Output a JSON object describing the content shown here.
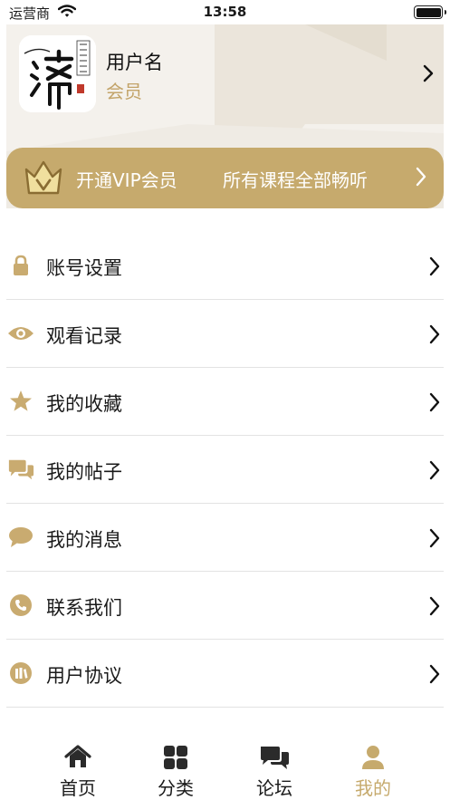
{
  "status_bar": {
    "carrier": "运营商",
    "time": "13:58"
  },
  "profile": {
    "username": "用户名",
    "member_level": "会员"
  },
  "vip_banner": {
    "open_label": "开通VIP会员",
    "description": "所有课程全部畅听"
  },
  "menu": {
    "items": [
      {
        "label": "账号设置",
        "icon": "lock-icon"
      },
      {
        "label": "观看记录",
        "icon": "eye-icon"
      },
      {
        "label": "我的收藏",
        "icon": "star-icon"
      },
      {
        "label": "我的帖子",
        "icon": "chat-bubbles-icon"
      },
      {
        "label": "我的消息",
        "icon": "message-icon"
      },
      {
        "label": "联系我们",
        "icon": "phone-icon"
      },
      {
        "label": "用户协议",
        "icon": "book-icon"
      }
    ]
  },
  "tabbar": {
    "items": [
      {
        "label": "首页",
        "icon": "home-icon"
      },
      {
        "label": "分类",
        "icon": "grid-icon"
      },
      {
        "label": "论坛",
        "icon": "forum-icon"
      },
      {
        "label": "我的",
        "icon": "person-icon",
        "active": true
      }
    ]
  },
  "colors": {
    "accent": "#c6aa6d",
    "icon_gold": "#c9ab70",
    "header_bg": "#f4f1ec"
  }
}
